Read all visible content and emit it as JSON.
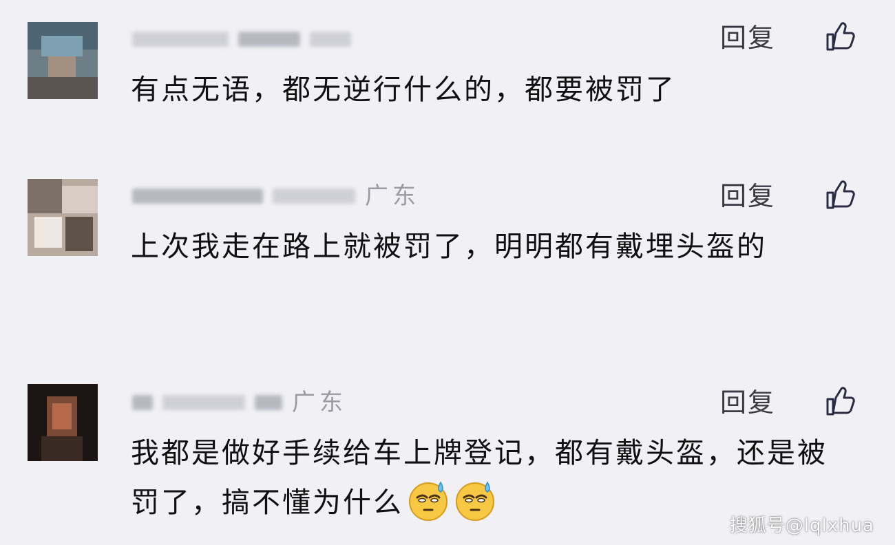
{
  "comments": [
    {
      "location": "",
      "reply_label": "回复",
      "text": "有点无语，都无逆行什么的，都要被罚了"
    },
    {
      "location": "广东",
      "reply_label": "回复",
      "text": "上次我走在路上就被罚了，明明都有戴埋头盔的"
    },
    {
      "location": "广东",
      "reply_label": "回复",
      "text": "我都是做好手续给车上牌登记，都有戴头盔，还是被罚了，搞不懂为什么"
    }
  ],
  "icons": {
    "like": "thumbs-up-icon",
    "emoji": "sweat-smile-emoji-icon"
  },
  "watermark": "搜狐号@lqlxhua"
}
